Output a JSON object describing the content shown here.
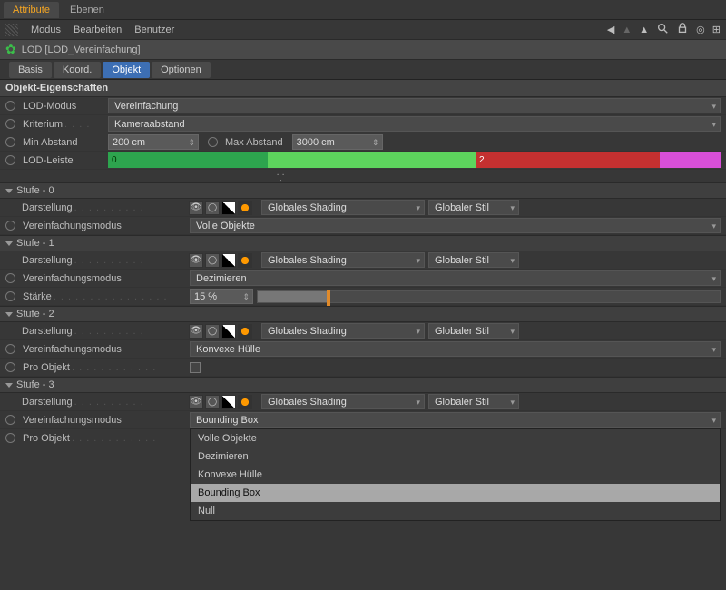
{
  "tabs_main": {
    "attribute": "Attribute",
    "ebenen": "Ebenen"
  },
  "menu": {
    "modus": "Modus",
    "bearbeiten": "Bearbeiten",
    "benutzer": "Benutzer"
  },
  "object_title": "LOD [LOD_Vereinfachung]",
  "tabs_sub": {
    "basis": "Basis",
    "koord": "Koord.",
    "objekt": "Objekt",
    "optionen": "Optionen"
  },
  "section_title": "Objekt-Eigenschaften",
  "props": {
    "lod_modus_label": "LOD-Modus",
    "lod_modus_value": "Vereinfachung",
    "kriterium_label": "Kriterium",
    "kriterium_value": "Kameraabstand",
    "min_abstand_label": "Min Abstand",
    "min_abstand_value": "200 cm",
    "max_abstand_label": "Max Abstand",
    "max_abstand_value": "3000 cm",
    "lod_leiste_label": "LOD-Leiste",
    "bar_labels": {
      "seg0": "0",
      "seg2": "2"
    }
  },
  "stages": [
    {
      "title": "Stufe - 0",
      "display_label": "Darstellung",
      "shading_value": "Globales Shading",
      "style_value": "Globaler Stil",
      "simpl_label": "Vereinfachungsmodus",
      "simpl_value": "Volle Objekte"
    },
    {
      "title": "Stufe - 1",
      "display_label": "Darstellung",
      "shading_value": "Globales Shading",
      "style_value": "Globaler Stil",
      "simpl_label": "Vereinfachungsmodus",
      "simpl_value": "Dezimieren",
      "strength_label": "Stärke",
      "strength_value": "15 %",
      "strength_pct": 15
    },
    {
      "title": "Stufe - 2",
      "display_label": "Darstellung",
      "shading_value": "Globales Shading",
      "style_value": "Globaler Stil",
      "simpl_label": "Vereinfachungsmodus",
      "simpl_value": "Konvexe Hülle",
      "perobj_label": "Pro Objekt"
    },
    {
      "title": "Stufe - 3",
      "display_label": "Darstellung",
      "shading_value": "Globales Shading",
      "style_value": "Globaler Stil",
      "simpl_label": "Vereinfachungsmodus",
      "simpl_value": "Bounding Box",
      "perobj_label": "Pro Objekt",
      "dropdown_options": [
        "Volle Objekte",
        "Dezimieren",
        "Konvexe Hülle",
        "Bounding Box",
        "Null"
      ],
      "dropdown_selected_index": 3
    }
  ]
}
